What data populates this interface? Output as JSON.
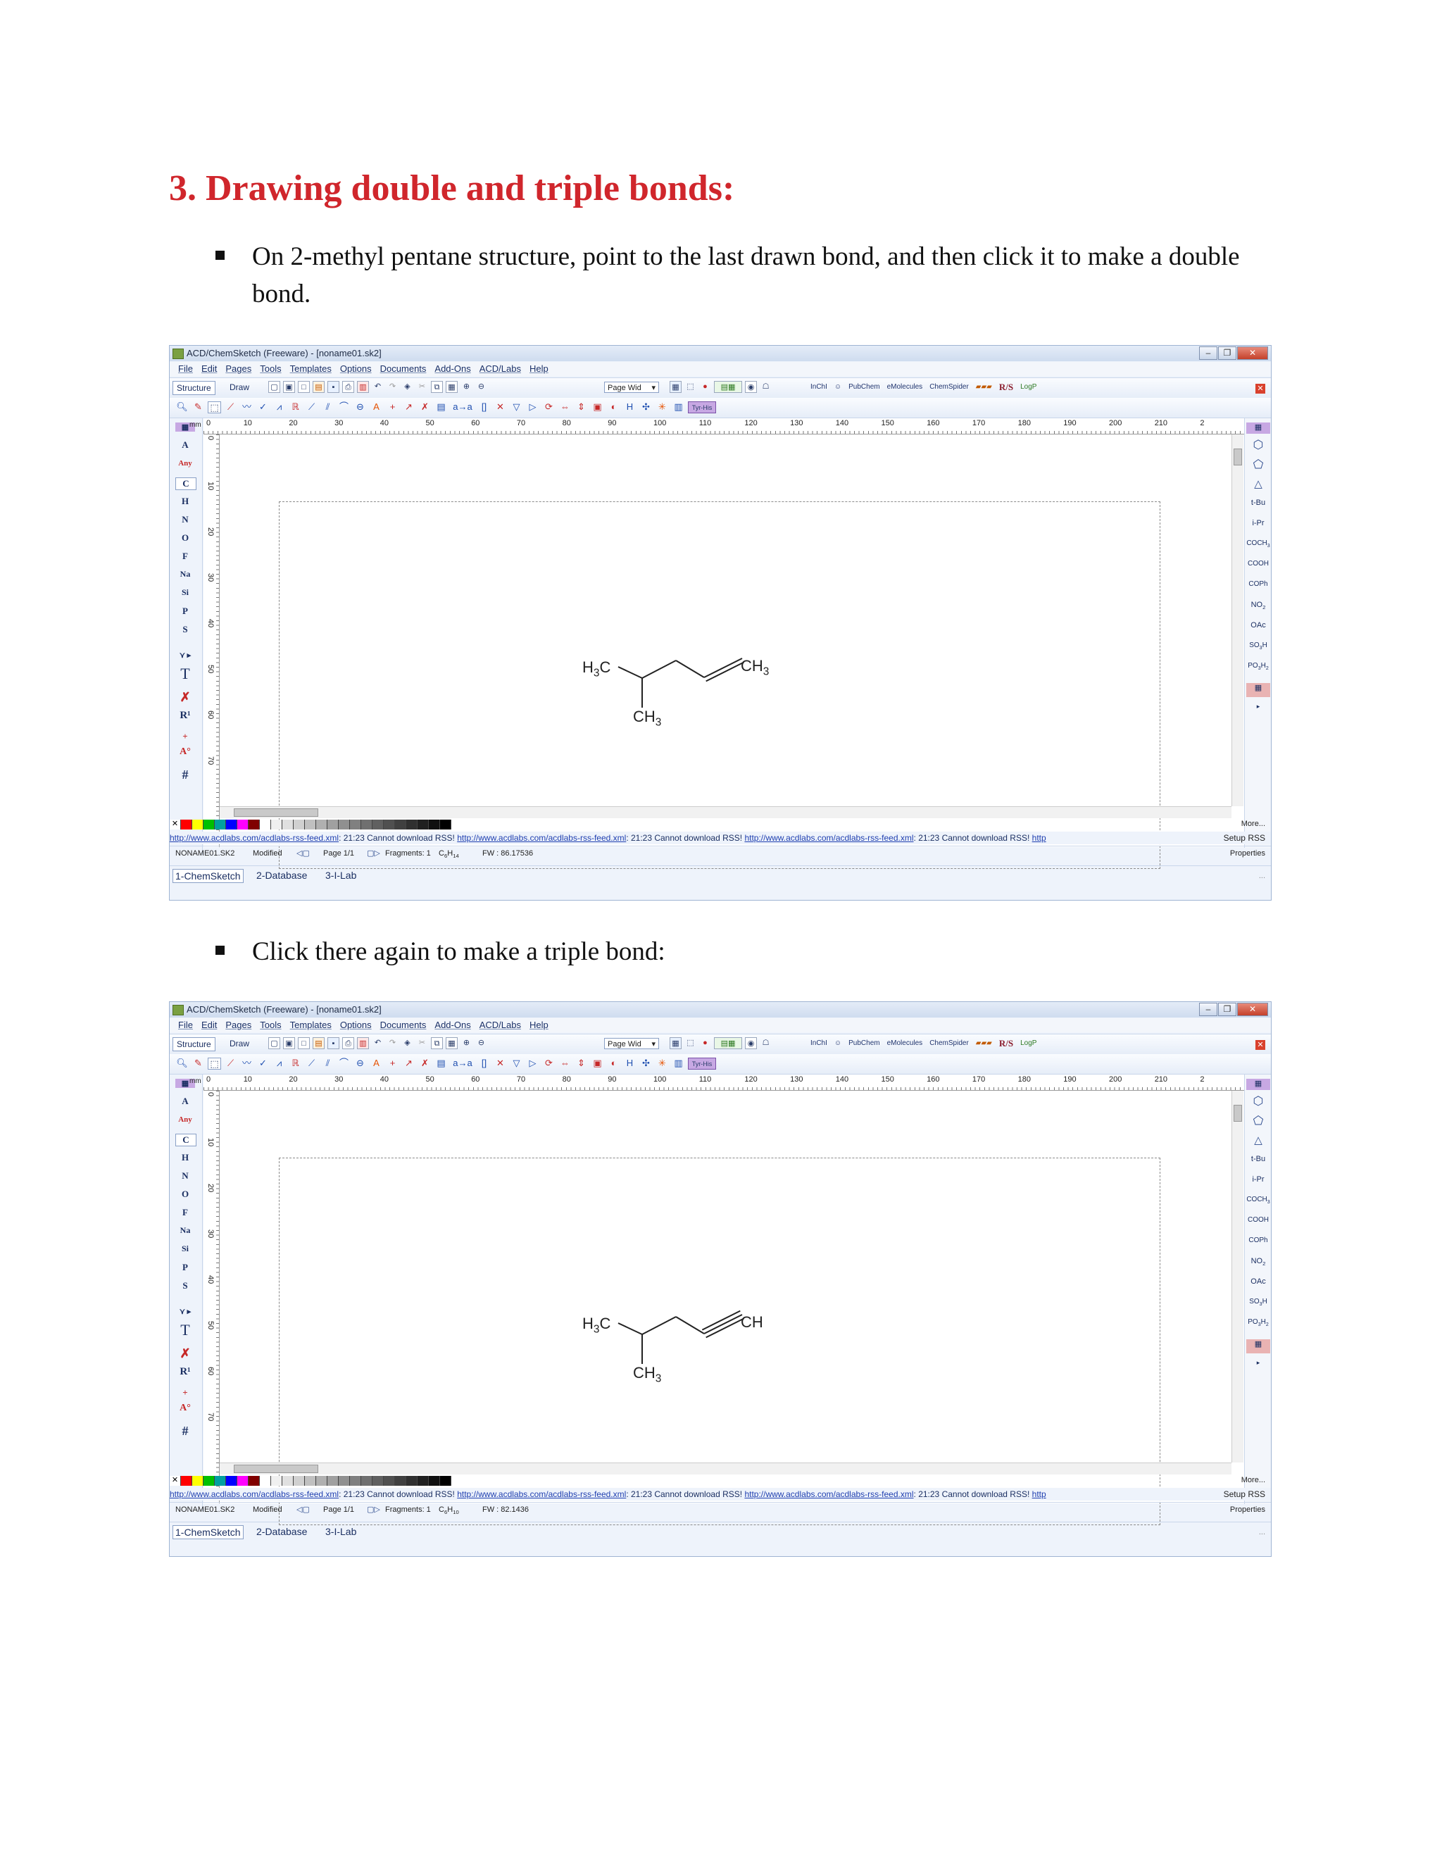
{
  "heading": "3. Drawing double and triple bonds:",
  "bullet1": "On 2-methyl pentane structure, point to the last drawn bond, and then click it to make a double bond.",
  "bullet2": "Click there again to make a triple bond:",
  "window": {
    "title": "ACD/ChemSketch (Freeware) - [noname01.sk2]",
    "menu": [
      "File",
      "Edit",
      "Pages",
      "Tools",
      "Templates",
      "Options",
      "Documents",
      "Add-Ons",
      "ACD/Labs",
      "Help"
    ],
    "mode_structure": "Structure",
    "mode_draw": "Draw",
    "zoom": "Page Wid",
    "web": [
      "InChI",
      "PubChem",
      "eMolecules",
      "ChemSpider"
    ],
    "rs": "R/S",
    "logp": "LogP",
    "ruler_unit": "mm",
    "ruler_top": [
      "0",
      "10",
      "20",
      "30",
      "40",
      "50",
      "60",
      "70",
      "80",
      "90",
      "100",
      "110",
      "120",
      "130",
      "140",
      "150",
      "160",
      "170",
      "180",
      "190",
      "200",
      "210",
      "2"
    ],
    "ruler_left": [
      "0",
      "10",
      "20",
      "30",
      "40",
      "50",
      "60",
      "70"
    ],
    "elements": [
      "A",
      "Any",
      "C",
      "H",
      "N",
      "O",
      "F",
      "Na",
      "Si",
      "P",
      "S"
    ],
    "templates": [
      "t-Bu",
      "i-Pr",
      "COCH3",
      "COOH",
      "COPh",
      "NO2",
      "OAc",
      "SO3H",
      "PO3H2"
    ],
    "more": "More...",
    "rss_url": "http://www.acdlabs.com/acdlabs-rss-feed.xml",
    "rss_msg": ": 21:23 Cannot download RSS!",
    "rss_tail": "http",
    "setup_rss": "Setup RSS",
    "properties": "Properties",
    "filename": "NONAME01.SK2",
    "modified": "Modified",
    "page": "Page 1/1",
    "fragments": "Fragments: 1",
    "tabs": [
      "1-ChemSketch",
      "2-Database",
      "3-I-Lab"
    ],
    "dots": "..."
  },
  "screen1": {
    "formula": "C6H14",
    "fw": "FW : 86.17536",
    "label_left": "H3C",
    "label_bottom": "CH3",
    "label_right": "CH3"
  },
  "screen2": {
    "formula": "C6H10",
    "fw": "FW : 82.1436",
    "label_left": "H3C",
    "label_bottom": "CH3",
    "label_right": "CH"
  },
  "colors": {
    "heading": "#d0262c"
  }
}
